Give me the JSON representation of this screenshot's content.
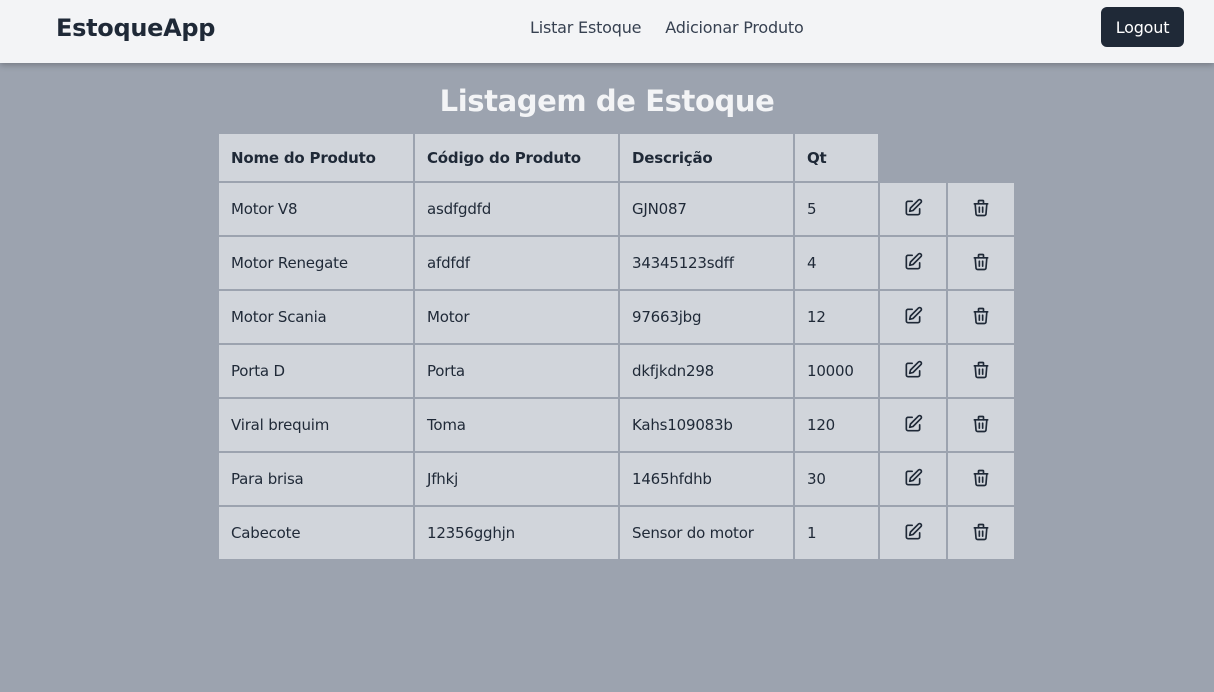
{
  "app": {
    "title": "EstoqueApp"
  },
  "nav": {
    "links": [
      "Listar Estoque",
      "Adicionar Produto"
    ],
    "logout_label": "Logout"
  },
  "page": {
    "title": "Listagem de Estoque"
  },
  "table": {
    "headers": [
      "Nome do Produto",
      "Código do Produto",
      "Descrição",
      "Qt"
    ],
    "rows": [
      [
        "Motor V8",
        "asdfgdfd",
        "GJN087",
        "5"
      ],
      [
        "Motor Renegate",
        "afdfdf",
        "34345123sdff",
        "4"
      ],
      [
        "Motor Scania",
        "Motor",
        "97663jbg",
        "12"
      ],
      [
        "Porta D",
        "Porta",
        "dkfjkdn298",
        "10000"
      ],
      [
        "Viral brequim",
        "Toma",
        "Kahs109083b",
        "120"
      ],
      [
        "Para brisa",
        "Jfhkj",
        "1465hfdhb",
        "30"
      ],
      [
        "Cabecote",
        "12356gghjn",
        "Sensor do motor",
        "1"
      ]
    ],
    "row_actions": [
      "edit-icon",
      "trash-icon"
    ]
  },
  "colors": {
    "background": "#9ca3af",
    "navbar": "#f3f4f6",
    "button": "#1f2937",
    "cell": "#d1d5db"
  }
}
